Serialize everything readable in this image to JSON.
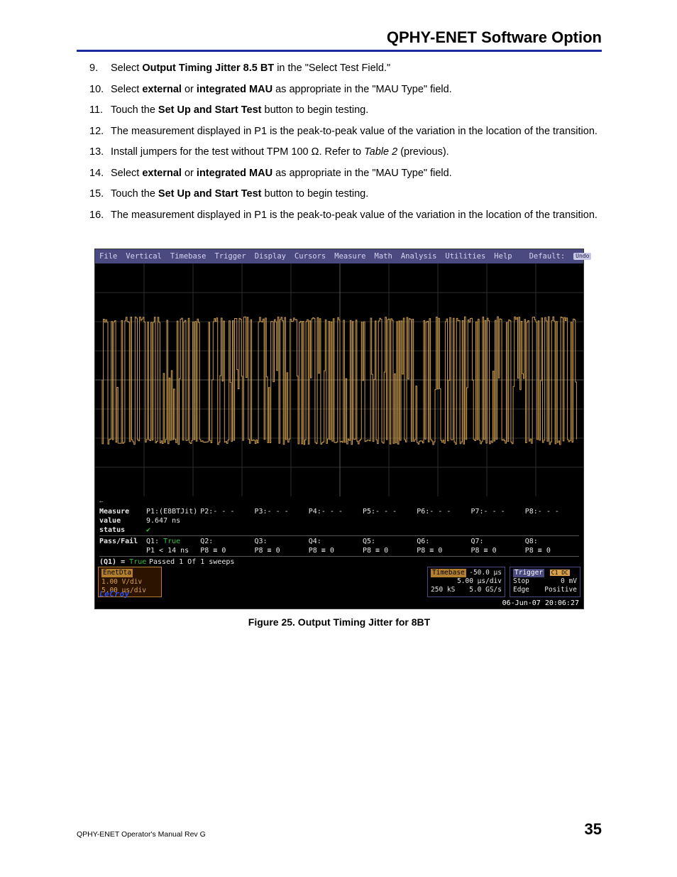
{
  "header": {
    "title": "QPHY-ENET Software Option"
  },
  "steps": [
    {
      "n": "9.",
      "segments": [
        {
          "t": "Select "
        },
        {
          "t": "Output Timing Jitter 8.5 BT",
          "b": true
        },
        {
          "t": " in the \"Select Test Field.\""
        }
      ]
    },
    {
      "n": "10.",
      "segments": [
        {
          "t": "Select "
        },
        {
          "t": "external",
          "b": true
        },
        {
          "t": " or "
        },
        {
          "t": "integrated MAU",
          "b": true
        },
        {
          "t": " as appropriate in the \"MAU Type\" field."
        }
      ]
    },
    {
      "n": "11.",
      "segments": [
        {
          "t": "Touch the "
        },
        {
          "t": "Set Up and Start Test",
          "b": true
        },
        {
          "t": " button to begin testing."
        }
      ]
    },
    {
      "n": "12.",
      "segments": [
        {
          "t": "The measurement displayed in P1 is the peak-to-peak value of the variation in the location of the transition."
        }
      ]
    },
    {
      "n": "13.",
      "segments": [
        {
          "t": "Install jumpers for the test without TPM 100 Ω. Refer to "
        },
        {
          "t": "Table 2",
          "i": true
        },
        {
          "t": " (previous)."
        }
      ]
    },
    {
      "n": "14.",
      "segments": [
        {
          "t": " Select "
        },
        {
          "t": "external",
          "b": true
        },
        {
          "t": " or "
        },
        {
          "t": "integrated MAU",
          "b": true
        },
        {
          "t": " as appropriate in the \"MAU Type\" field."
        }
      ]
    },
    {
      "n": "15.",
      "segments": [
        {
          "t": "Touch the "
        },
        {
          "t": "Set Up and Start Test",
          "b": true
        },
        {
          "t": " button to begin testing."
        }
      ]
    },
    {
      "n": "16.",
      "segments": [
        {
          "t": "The measurement displayed in P1 is the peak-to-peak value of the variation in the location of the transition."
        }
      ]
    }
  ],
  "scope": {
    "menu": [
      "File",
      "Vertical",
      "Timebase",
      "Trigger",
      "Display",
      "Cursors",
      "Measure",
      "Math",
      "Analysis",
      "Utilities",
      "Help"
    ],
    "menu_right_label": "Default:",
    "undo_label": "Undo",
    "measure": {
      "row_labels": [
        "Measure",
        "value",
        "status"
      ],
      "cols": [
        {
          "name": "P1:(E8BTJit)",
          "value": "9.647 ns",
          "status": "✔"
        },
        {
          "name": "P2:- - -",
          "value": "",
          "status": ""
        },
        {
          "name": "P3:- - -",
          "value": "",
          "status": ""
        },
        {
          "name": "P4:- - -",
          "value": "",
          "status": ""
        },
        {
          "name": "P5:- - -",
          "value": "",
          "status": ""
        },
        {
          "name": "P6:- - -",
          "value": "",
          "status": ""
        },
        {
          "name": "P7:- - -",
          "value": "",
          "status": ""
        },
        {
          "name": "P8:- - -",
          "value": "",
          "status": ""
        }
      ]
    },
    "passfail": {
      "label": "Pass/Fail",
      "q": [
        {
          "name": "Q1:",
          "result": "True",
          "cond": "P1 < 14 ns"
        },
        {
          "name": "Q2:",
          "result": "",
          "cond": "P8 ≡ 0"
        },
        {
          "name": "Q3:",
          "result": "",
          "cond": "P8 ≡ 0"
        },
        {
          "name": "Q4:",
          "result": "",
          "cond": "P8 ≡ 0"
        },
        {
          "name": "Q5:",
          "result": "",
          "cond": "P8 ≡ 0"
        },
        {
          "name": "Q6:",
          "result": "",
          "cond": "P8 ≡ 0"
        },
        {
          "name": "Q7:",
          "result": "",
          "cond": "P8 ≡ 0"
        },
        {
          "name": "Q8:",
          "result": "",
          "cond": "P8 ≡ 0"
        }
      ],
      "q_summary_label": "(Q1) =",
      "q_summary_value": "True",
      "sweep_text": "Passed 1  Of 1   sweeps"
    },
    "channel": {
      "name": "EnetDta",
      "vdiv": "1.00 V/div",
      "tdiv": "5.00 µs/div"
    },
    "timebase": {
      "label": "Timebase",
      "offset": "-50.0 µs",
      "tdiv": "5.00 µs/div",
      "rec": "250 kS",
      "rate": "5.0 GS/s"
    },
    "trigger": {
      "label": "Trigger",
      "badges": "C1 DC",
      "mode": "Stop",
      "level": "0 mV",
      "slope": "Edge",
      "pol": "Positive"
    },
    "brand": "LeCroy",
    "timestamp": "06-Jun-07 20:06:27"
  },
  "figure_caption": "Figure 25. Output Timing Jitter for 8BT",
  "footer": {
    "left": "QPHY-ENET Operator's Manual Rev G",
    "page": "35"
  }
}
